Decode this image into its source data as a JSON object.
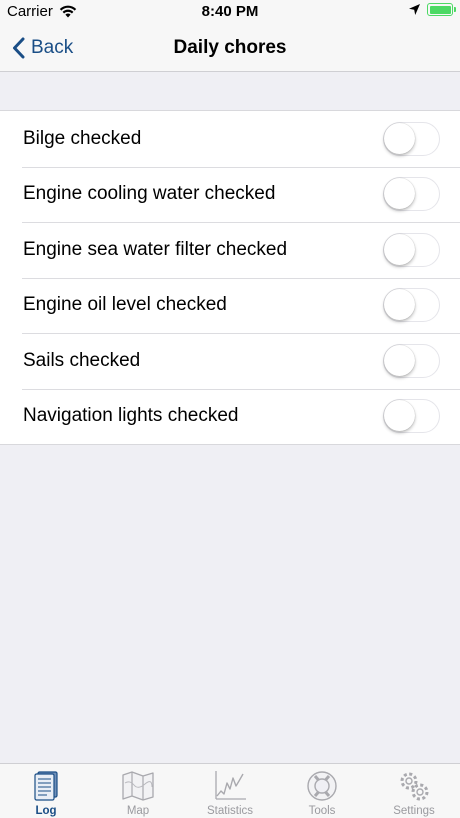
{
  "status_bar": {
    "carrier": "Carrier",
    "time": "8:40 PM"
  },
  "nav": {
    "back_label": "Back",
    "title": "Daily chores"
  },
  "chores": [
    {
      "label": "Bilge checked",
      "on": false
    },
    {
      "label": "Engine cooling water checked",
      "on": false
    },
    {
      "label": "Engine sea water filter checked",
      "on": false
    },
    {
      "label": "Engine oil level checked",
      "on": false
    },
    {
      "label": "Sails checked",
      "on": false
    },
    {
      "label": "Navigation lights checked",
      "on": false
    }
  ],
  "tabs": [
    {
      "label": "Log",
      "icon": "logbook-icon",
      "active": true
    },
    {
      "label": "Map",
      "icon": "map-icon",
      "active": false
    },
    {
      "label": "Statistics",
      "icon": "chart-icon",
      "active": false
    },
    {
      "label": "Tools",
      "icon": "lifebuoy-icon",
      "active": false
    },
    {
      "label": "Settings",
      "icon": "gears-icon",
      "active": false
    }
  ],
  "colors": {
    "accent": "#1a4e86",
    "battery": "#4cd964",
    "background": "#efeff4"
  }
}
